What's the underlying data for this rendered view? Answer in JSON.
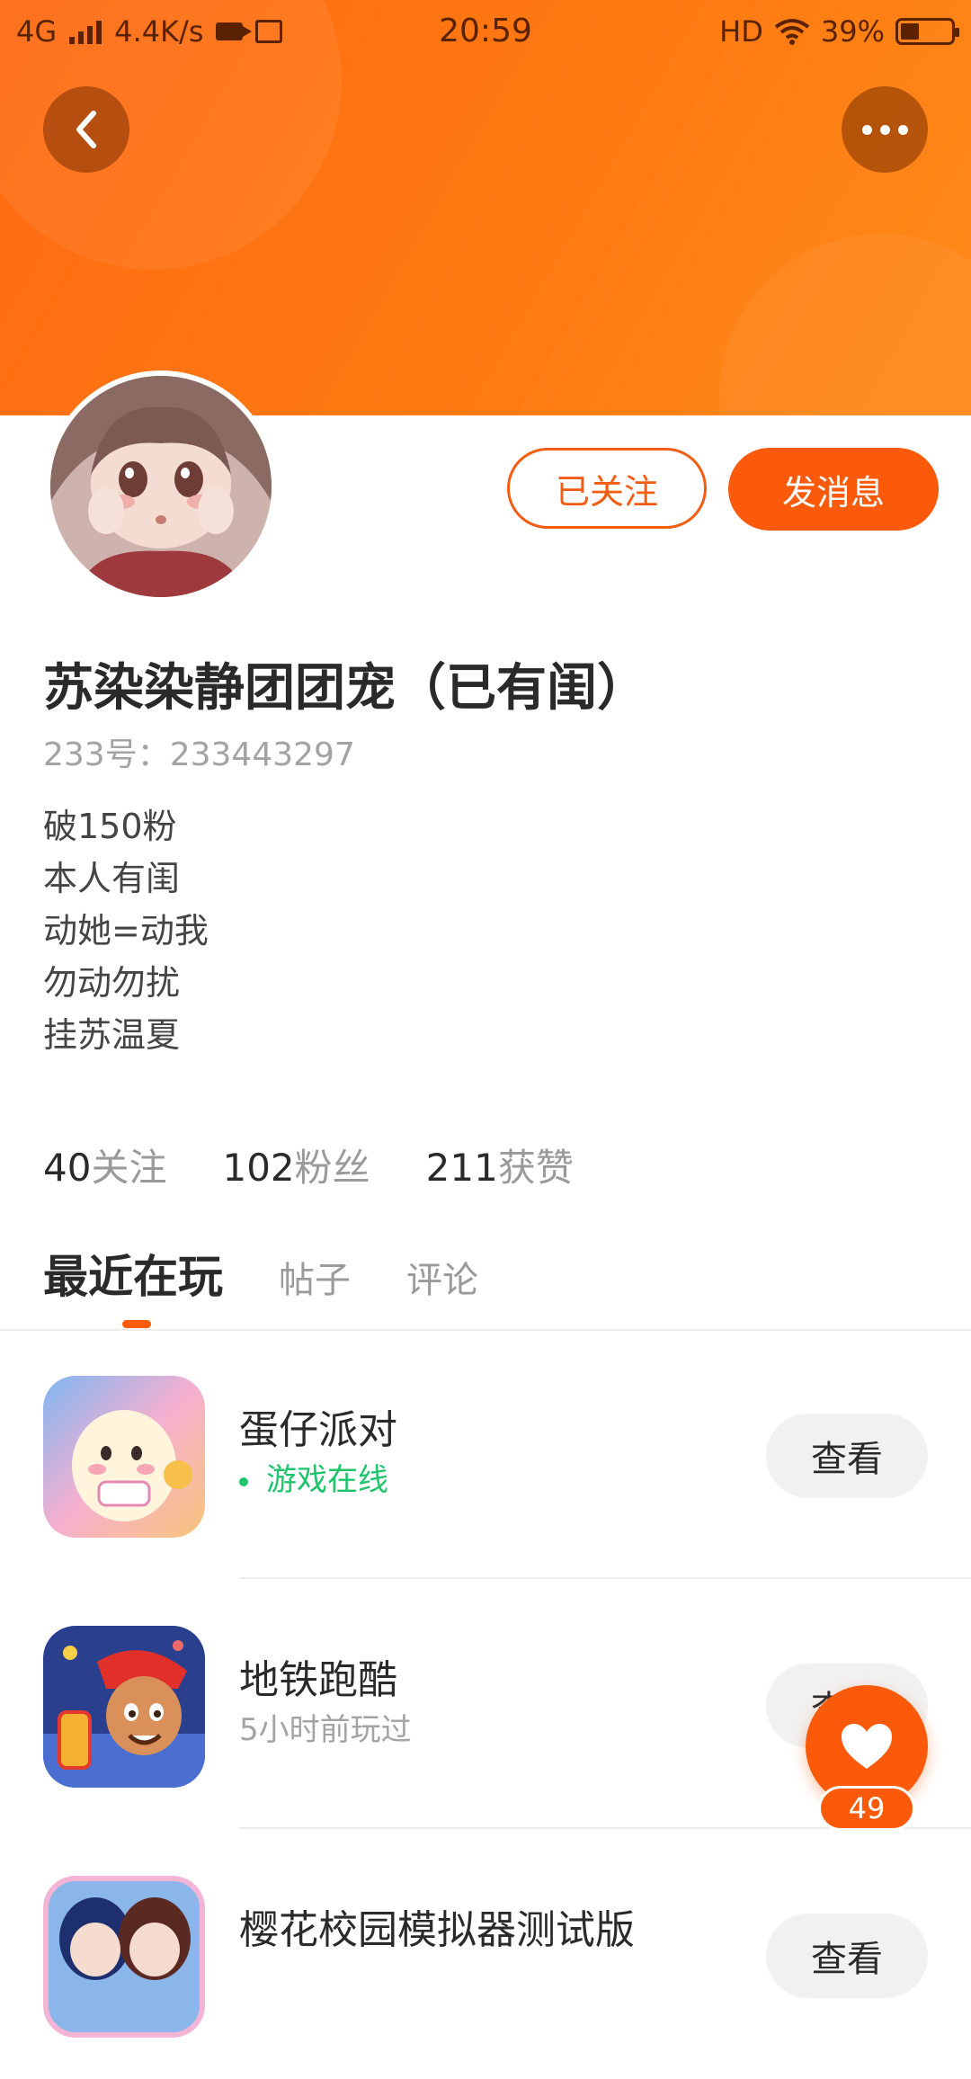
{
  "status_bar": {
    "network": "4G",
    "speed": "4.4K/s",
    "time": "20:59",
    "hd": "HD",
    "battery": "39%"
  },
  "header": {
    "back_icon": "chevron-left-icon",
    "more_icon": "more-dots-icon",
    "gradient_color": "#ff6a13"
  },
  "profile": {
    "followed_label": "已关注",
    "message_label": "发消息",
    "name": "苏染染静团团宠（已有闺）",
    "uid": "233号：233443297",
    "bio": [
      "破150粉",
      "本人有闺",
      "动她=动我",
      "勿动勿扰",
      "挂苏温夏"
    ],
    "stats": [
      {
        "num": "40",
        "label": "关注"
      },
      {
        "num": "102",
        "label": "粉丝"
      },
      {
        "num": "211",
        "label": "获赞"
      }
    ]
  },
  "tabs": [
    "最近在玩",
    "帖子",
    "评论"
  ],
  "games": [
    {
      "name": "蛋仔派对",
      "status": "游戏在线",
      "online": true,
      "button": "查看"
    },
    {
      "name": "地铁跑酷",
      "status": "5小时前玩过",
      "online": false,
      "button": "查看"
    },
    {
      "name": "樱花校园模拟器测试版",
      "status": "",
      "online": false,
      "button": "查看"
    }
  ],
  "like_fab": {
    "icon": "heart-icon",
    "count": "49"
  },
  "colors": {
    "accent": "#fa5a0a",
    "online": "#1fc46d"
  }
}
